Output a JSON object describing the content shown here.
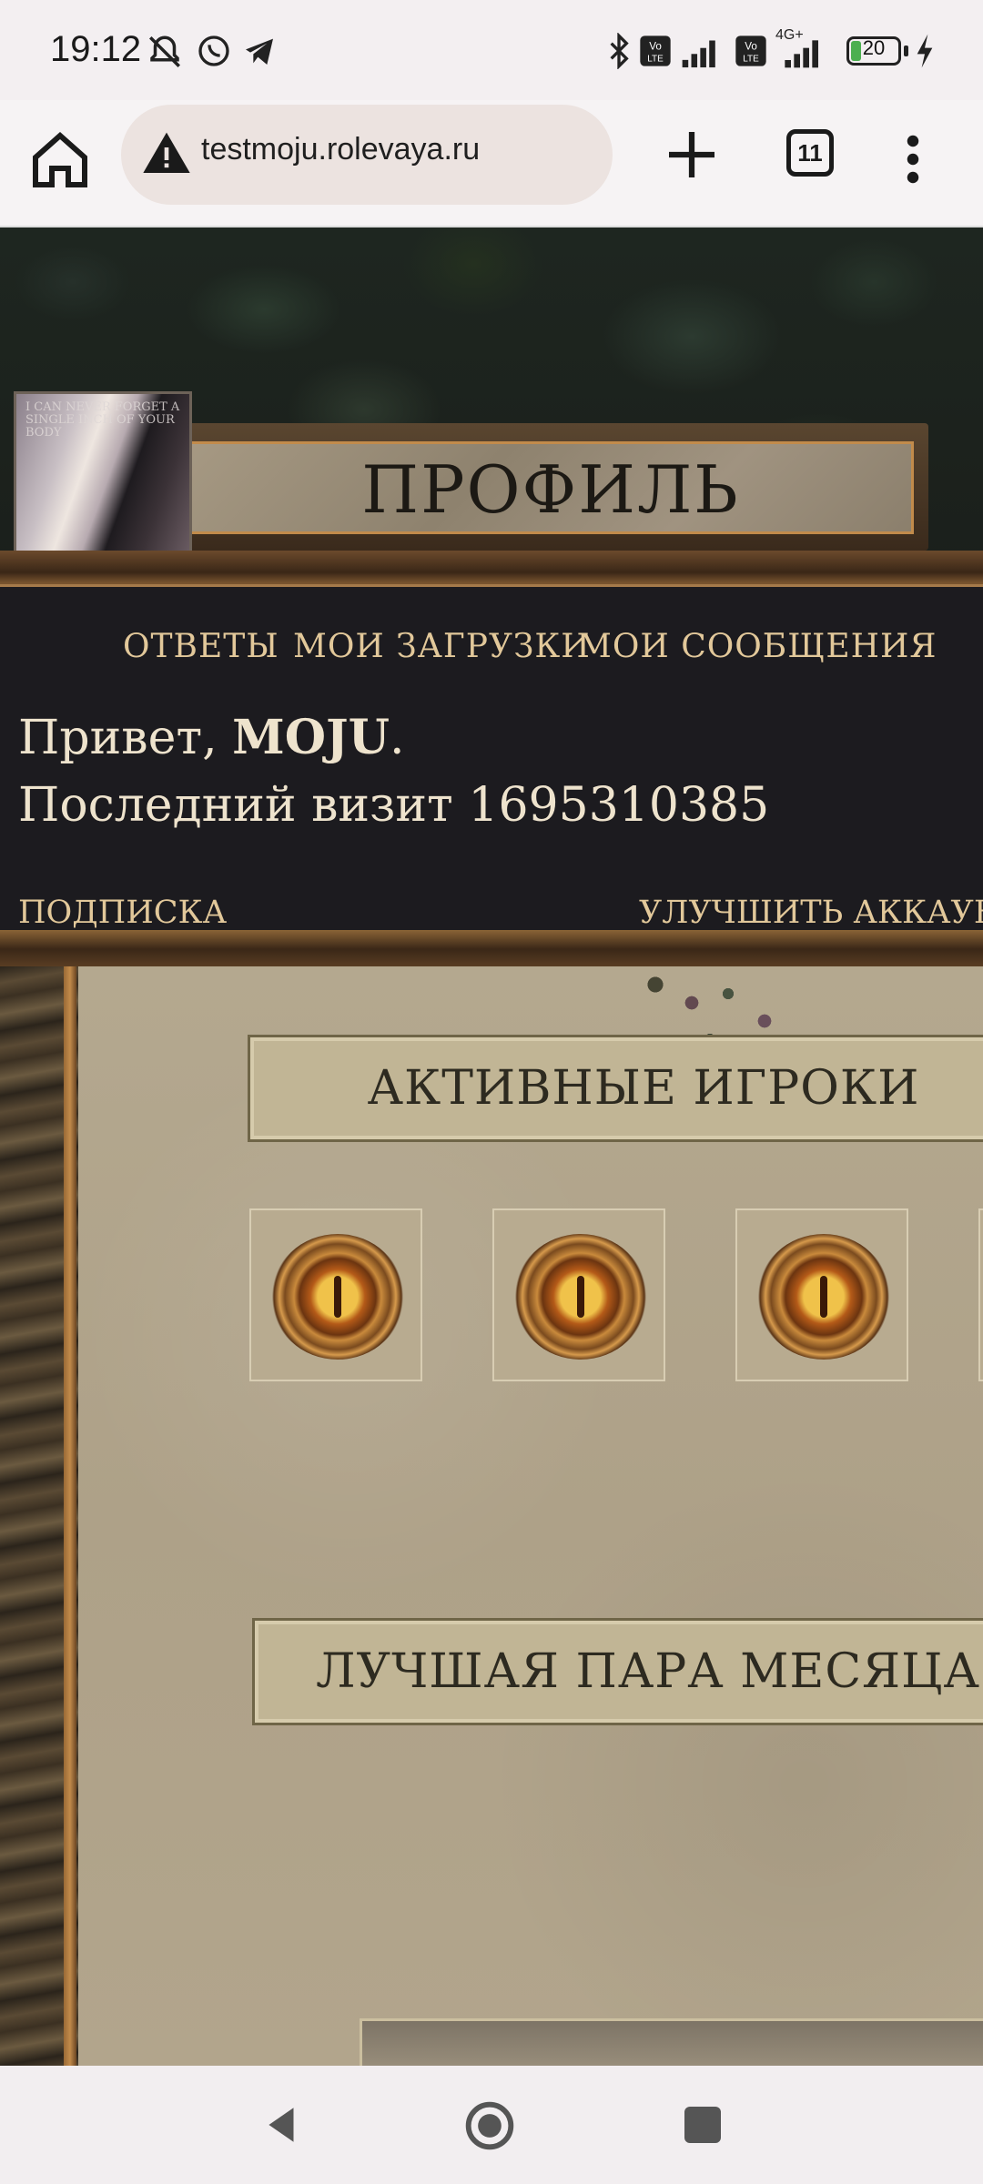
{
  "status_bar": {
    "time": "19:12",
    "battery": "20",
    "battery_level": 0.2,
    "network": "4G+",
    "icons": [
      "mute-icon",
      "whatsapp-icon",
      "telegram-icon",
      "bluetooth-icon",
      "volte-icon",
      "signal-icon",
      "charging-icon"
    ]
  },
  "browser": {
    "url": "testmoju.rolevaya.ru",
    "tab_count": "11",
    "icons": [
      "home-icon",
      "warning-icon",
      "plus-icon",
      "menu-icon"
    ]
  },
  "page": {
    "profile_title": "ПРОФИЛЬ",
    "avatar_text": "I CAN NEVER FORGET A SINGLE INCH OF YOUR BODY",
    "nav": {
      "answers": "ОТВЕТЫ",
      "uploads": "МОИ ЗАГРУЗКИ",
      "messages": "МОИ СООБЩЕНИЯ"
    },
    "greeting_prefix": "Привет, ",
    "username": "MOJU",
    "greeting_suffix": ".",
    "last_visit": "Последний визит 1695310385",
    "subscribe": "ПОДПИСКА",
    "upgrade": "УЛУЧШИТЬ АККАУНТ",
    "active_players_heading": "АКТИВНЫЕ ИГРОКИ",
    "best_pair_heading": "ЛУЧШАЯ ПАРА МЕСЯЦА"
  },
  "colors": {
    "accent_gold": "#e2c89a",
    "panel_dark": "#1c1b1f",
    "parchment": "#b0a38a",
    "battery_green": "#4caf50"
  }
}
